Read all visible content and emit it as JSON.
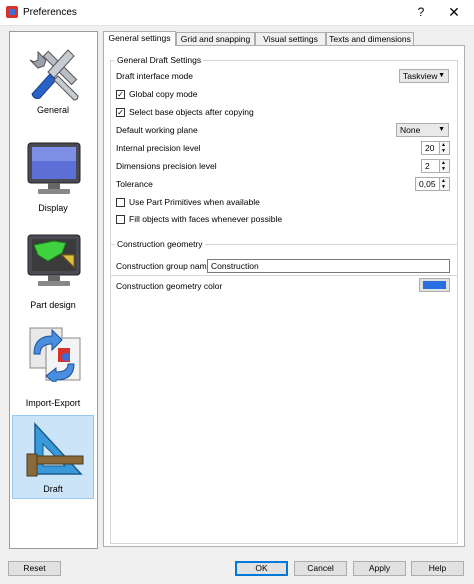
{
  "window": {
    "title": "Preferences",
    "help_glyph": "?",
    "close_glyph": "✕",
    "app_icon": "freecad-app-icon"
  },
  "sidebar": {
    "items": [
      {
        "label": "General",
        "icon": "tools-icon"
      },
      {
        "label": "Display",
        "icon": "monitor-icon"
      },
      {
        "label": "Part design",
        "icon": "part-design-icon"
      },
      {
        "label": "Import-Export",
        "icon": "import-export-icon"
      },
      {
        "label": "Draft",
        "icon": "draft-icon",
        "selected": true
      }
    ]
  },
  "tabs": [
    {
      "label": "General settings",
      "active": true
    },
    {
      "label": "Grid and snapping"
    },
    {
      "label": "Visual settings"
    },
    {
      "label": "Texts and dimensions"
    }
  ],
  "general_draft": {
    "title": "General Draft Settings",
    "interface_mode": {
      "label": "Draft interface mode",
      "value": "Taskview"
    },
    "global_copy": {
      "label": "Global copy mode",
      "checked": true
    },
    "select_base": {
      "label": "Select base objects after copying",
      "checked": true
    },
    "working_plane": {
      "label": "Default working plane",
      "value": "None"
    },
    "internal_precision": {
      "label": "Internal precision level",
      "value": "20"
    },
    "dimensions_precision": {
      "label": "Dimensions precision level",
      "value": "2"
    },
    "tolerance": {
      "label": "Tolerance",
      "value": "0,05"
    },
    "use_part_primitives": {
      "label": "Use Part Primitives when available",
      "checked": false
    },
    "fill_objects": {
      "label": "Fill objects with faces whenever possible",
      "checked": false
    }
  },
  "construction": {
    "title": "Construction geometry",
    "group_name": {
      "label": "Construction group name",
      "value": "Construction"
    },
    "color": {
      "label": "Construction geometry color",
      "value": "#2a6fe0"
    }
  },
  "buttons": {
    "reset": "Reset",
    "ok": "OK",
    "cancel": "Cancel",
    "apply": "Apply",
    "help": "Help"
  },
  "glyphs": {
    "combo_arrow": "▼",
    "spin_up": "▲",
    "spin_down": "▼",
    "check": "✓"
  }
}
